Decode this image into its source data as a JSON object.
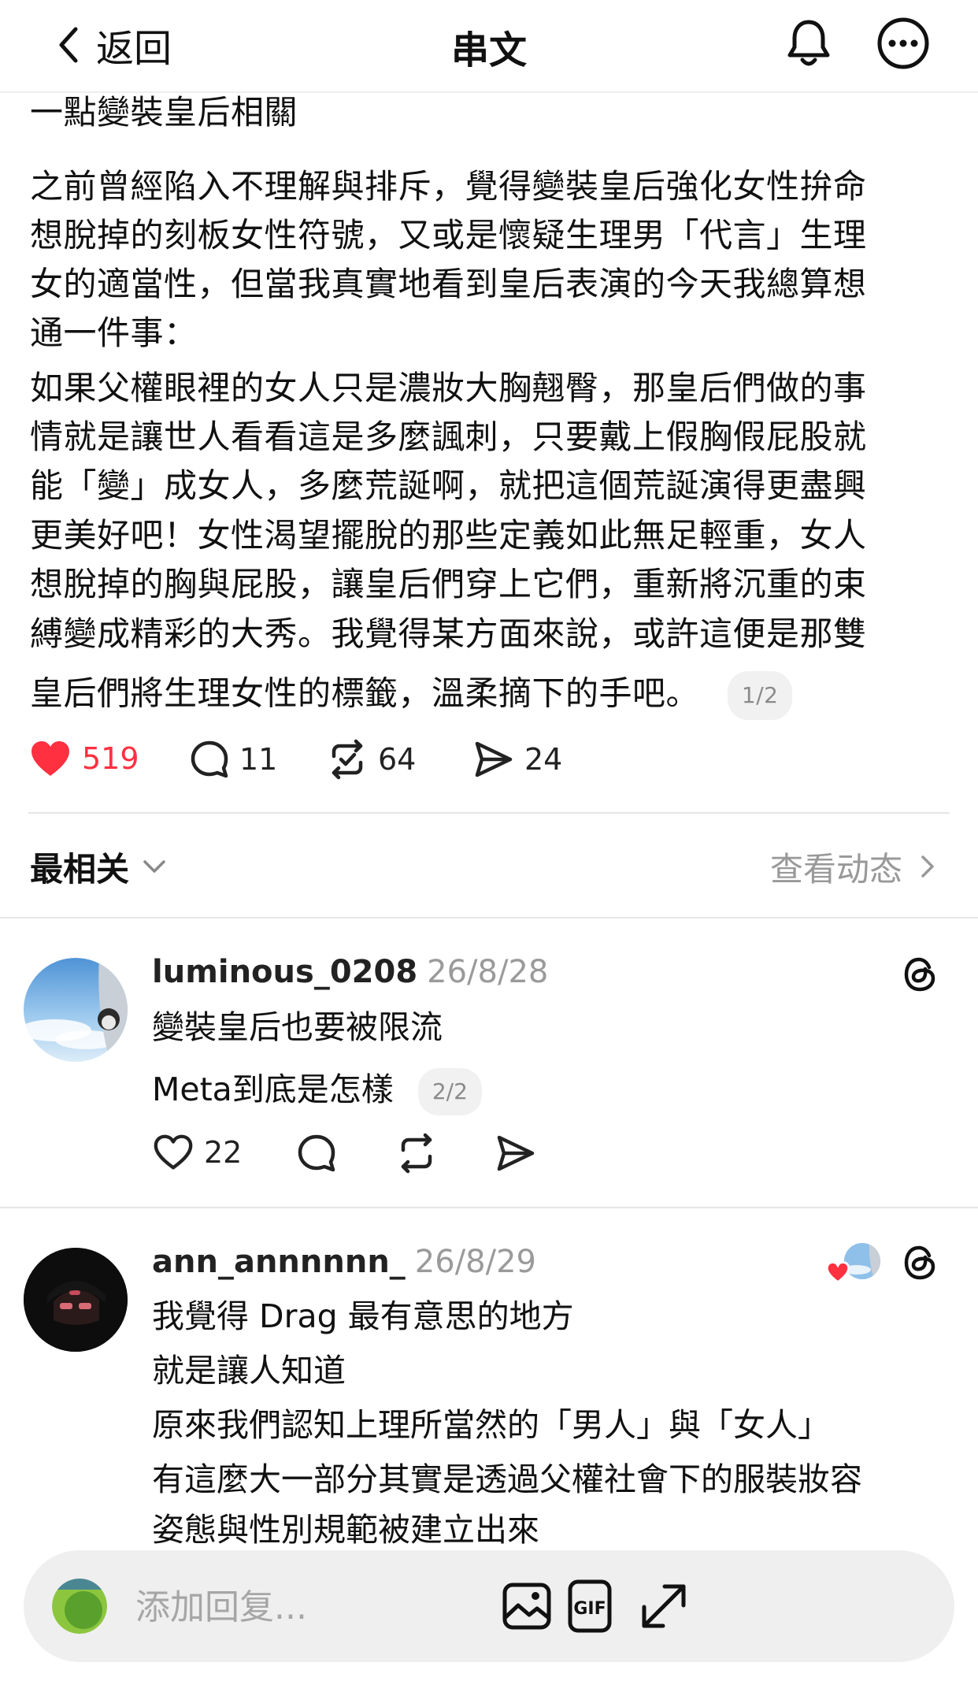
{
  "header": {
    "back_label": "返回",
    "title": "串文"
  },
  "post": {
    "lines": [
      "一點變裝皇后相關",
      "之前曾經陷入不理解與排斥，覺得變裝皇后強化女性拚命",
      "想脫掉的刻板女性符號，又或是懷疑生理男「代言」生理",
      "女的適當性，但當我真實地看到皇后表演的今天我總算想",
      "通一件事：",
      "如果父權眼裡的女人只是濃妝大胸翹臀，那皇后們做的事",
      "情就是讓世人看看這是多麼諷刺，只要戴上假胸假屁股就",
      "能「變」成女人，多麼荒誕啊，就把這個荒誕演得更盡興",
      "更美好吧！女性渴望擺脫的那些定義如此無足輕重，女人",
      "想脫掉的胸與屁股，讓皇后們穿上它們，重新將沉重的束",
      "縛變成精彩的大秀。我覺得某方面來說，或許這便是那雙",
      "皇后們將生理女性的標籤，溫柔摘下的手吧。"
    ],
    "page_badge": "1/2",
    "likes": "519",
    "comments": "11",
    "reposts": "64",
    "shares": "24"
  },
  "sort": {
    "label": "最相关",
    "activity_label": "查看动态"
  },
  "replies": [
    {
      "username": "luminous_0208",
      "date": "26/8/28",
      "lines": [
        "變裝皇后也要被限流",
        "Meta到底是怎樣"
      ],
      "page_badge": "2/2",
      "likes": "22"
    },
    {
      "username": "ann_annnnnn_",
      "date": "26/8/29",
      "lines": [
        "我覺得 Drag 最有意思的地方",
        "就是讓人知道",
        "原來我們認知上理所當然的「男人」與「女人」",
        "有這麼大一部分其實是透過父權社會下的服裝妝容",
        "姿態與性別規範被建立出來"
      ]
    }
  ],
  "composer": {
    "placeholder": "添加回复..."
  },
  "colors": {
    "like_red": "#ff3040",
    "muted_gray": "#9a9a9a",
    "divider": "#e6e6e6",
    "composer_bg": "#efefef"
  },
  "icons": [
    "chevron-left-icon",
    "bell-icon",
    "more-icon",
    "heart-icon",
    "comment-icon",
    "repost-icon",
    "share-icon",
    "chevron-down-icon",
    "chevron-right-icon",
    "threads-icon",
    "image-icon",
    "gif-icon",
    "expand-icon"
  ]
}
